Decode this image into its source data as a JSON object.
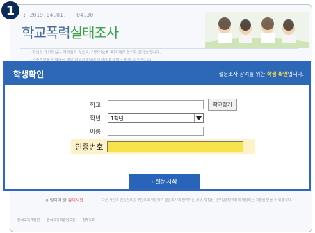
{
  "step_number": "1",
  "background": {
    "period": ": 2019.04.01. ~ 04.30.",
    "title_main": "학교폭력",
    "title_accent": "실태조사",
    "notices": [
      "· 학생의 개인정보는 저장되지 않으며, 인증번호를 통한 개인 확인은 불가능합니다.",
      "· 인증번호를 입력하신 경우 담임선생님께 요청하여 재발급 받을 수 있습니다."
    ],
    "bottom_link_prefix": "※ 알아야 할",
    "bottom_link_red": "유의사항",
    "bottom_note": "· 다른 사람의 인증번호를 무단으로 이용하여 설문조사에 참여하는 경우, 형법상 공무집행방해죄에 해당되는 처벌을 받을 수 있습니다.",
    "footer_logos": [
      "한국교육개발원",
      "한국교육학술정보원",
      "정부3.0"
    ]
  },
  "modal": {
    "title": "학생확인",
    "subtitle_prefix": "설문조사 참여를 위한 ",
    "subtitle_highlight": "학생 확인",
    "subtitle_suffix": "입니다.",
    "fields": {
      "school_label": "학교",
      "school_value": "",
      "find_school_button": "학교찾기",
      "grade_label": "학년",
      "grade_selected": "1학년",
      "name_label": "이름",
      "name_value": "",
      "auth_label": "인증번호",
      "auth_value": ""
    },
    "start_button": "› 설문시작"
  },
  "colors": {
    "header_blue": "#2d68b6",
    "highlight_yellow": "#ffe245",
    "auth_field": "#f6e44a",
    "modal_border": "#2f66c5"
  }
}
